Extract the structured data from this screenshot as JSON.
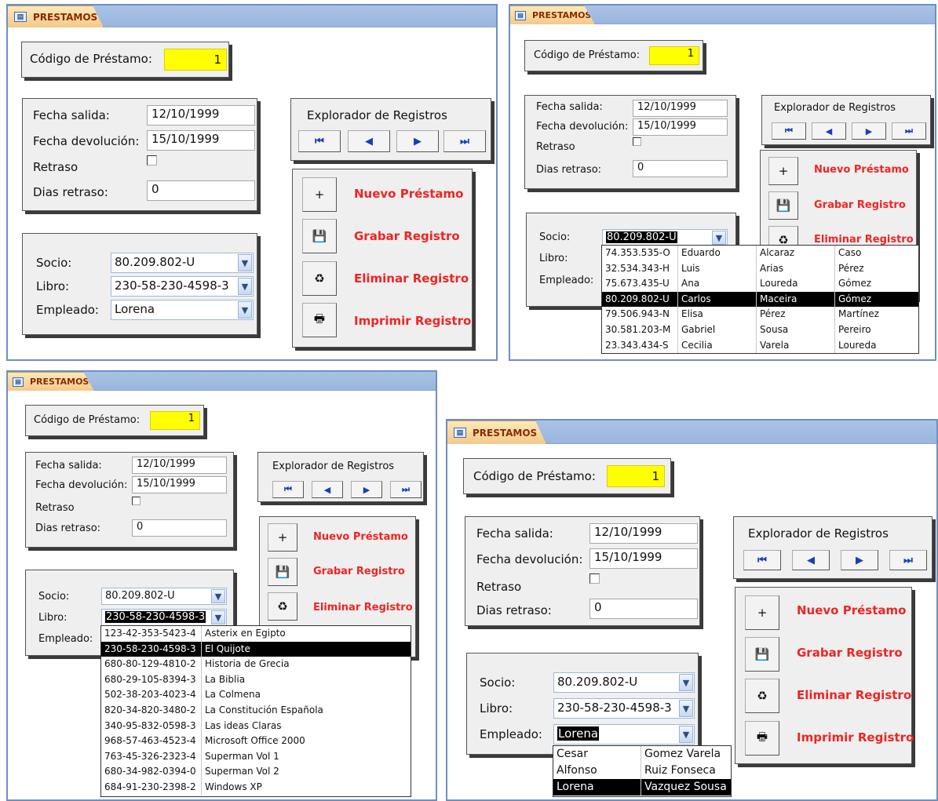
{
  "form": {
    "tab_title": "PRESTAMOS",
    "codigo_label": "Código de Préstamo:",
    "codigo_value": "1",
    "fecha_salida_label": "Fecha salida:",
    "fecha_salida_value": "12/10/1999",
    "fecha_devolucion_label": "Fecha devolución:",
    "fecha_devolucion_value": "15/10/1999",
    "retraso_label": "Retraso",
    "dias_retraso_label": "Dias retraso:",
    "dias_retraso_value": "0",
    "explorer_title": "Explorador de Registros",
    "nav": {
      "first": "⏮",
      "prev": "◀",
      "next": "▶",
      "last": "⏭"
    },
    "actions": {
      "nuevo": "Nuevo Préstamo",
      "grabar": "Grabar Registro",
      "eliminar": "Eliminar Registro",
      "imprimir": "Imprimir Registro"
    },
    "socio_label": "Socio:",
    "socio_value": "80.209.802-U",
    "libro_label": "Libro:",
    "libro_value": "230-58-230-4598-3",
    "empleado_label": "Empleado:",
    "empleado_value": "Lorena"
  },
  "socio_list": [
    [
      "74.353.535-O",
      "Eduardo",
      "Alcaraz",
      "Caso"
    ],
    [
      "32.534.343-H",
      "Luis",
      "Arias",
      "Pérez"
    ],
    [
      "75.673.435-U",
      "Ana",
      "Loureda",
      "Gómez"
    ],
    [
      "80.209.802-U",
      "Carlos",
      "Maceira",
      "Gómez"
    ],
    [
      "79.506.943-N",
      "Elisa",
      "Pérez",
      "Martínez"
    ],
    [
      "30.581.203-M",
      "Gabriel",
      "Sousa",
      "Pereiro"
    ],
    [
      "23.343.434-S",
      "Cecilia",
      "Varela",
      "Loureda"
    ]
  ],
  "libro_list": [
    [
      "123-42-353-5423-4",
      "Asterix en Egipto"
    ],
    [
      "230-58-230-4598-3",
      "El Quijote"
    ],
    [
      "680-80-129-4810-2",
      "Historia de Grecia"
    ],
    [
      "680-29-105-8394-3",
      "La Biblia"
    ],
    [
      "502-38-203-4023-4",
      "La Colmena"
    ],
    [
      "820-34-820-3480-2",
      "La Constitución Española"
    ],
    [
      "340-95-832-0598-3",
      "Las ideas Claras"
    ],
    [
      "968-57-463-4523-4",
      "Microsoft Office 2000"
    ],
    [
      "763-45-326-2323-4",
      "Superman Vol 1"
    ],
    [
      "680-34-982-0394-0",
      "Superman Vol 2"
    ],
    [
      "684-91-230-2398-2",
      "Windows XP"
    ]
  ],
  "empleado_list": [
    [
      "Cesar",
      "Gomez Varela"
    ],
    [
      "Alfonso",
      "Ruiz Fonseca"
    ],
    [
      "Lorena",
      "Vazquez Sousa"
    ]
  ],
  "colors": {
    "highlight_field": "#ffff00",
    "action_text": "#f02424",
    "nav_arrow": "#1540b8",
    "window_border": "#6d8fc4"
  }
}
